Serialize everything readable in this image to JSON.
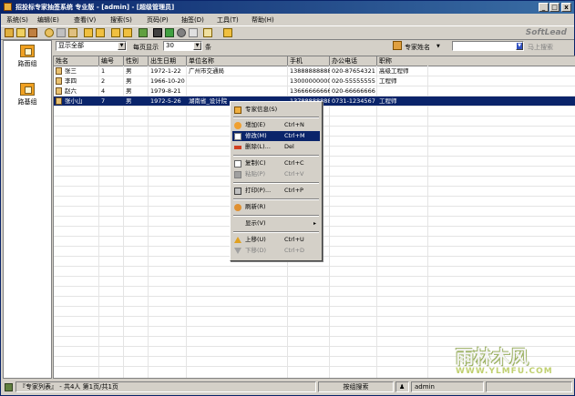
{
  "window": {
    "title": "招投标专家抽签系统 专业版 - [admin] - [超级管理员]",
    "min_label": "_",
    "max_label": "□",
    "close_label": "x"
  },
  "menu": [
    "系统(S)",
    "编辑(E)",
    "查看(V)",
    "搜索(S)",
    "页码(P)",
    "抽签(D)",
    "工具(T)",
    "帮助(H)"
  ],
  "toolbar": {
    "brand": "SoftLead"
  },
  "left_panel": {
    "items": [
      {
        "label": "路面组"
      },
      {
        "label": "路基组"
      }
    ]
  },
  "filter": {
    "show_select": "显示全部",
    "per_page_label": "每页显示",
    "per_page_value": "30",
    "per_page_unit": "条",
    "search_field_select": "专家姓名",
    "search_input": "",
    "search_button": "马上搜索"
  },
  "table": {
    "columns": [
      "姓名",
      "编号",
      "性别",
      "出生日期",
      "单位名称",
      "手机",
      "办公电话",
      "职称"
    ],
    "rows": [
      [
        "张三",
        "1",
        "男",
        "1972-1-22",
        "广州市交通局",
        "13888888888",
        "020-87654321",
        "高级工程师"
      ],
      [
        "李四",
        "2",
        "男",
        "1966-10-20",
        "",
        "13000000000",
        "020-55555555",
        "工程师"
      ],
      [
        "赵六",
        "4",
        "男",
        "1979-8-21",
        "",
        "13666666666",
        "020-66666666",
        ""
      ],
      [
        "张小山",
        "7",
        "男",
        "1972-5-26",
        "湖南省_设计院",
        "13788888888",
        "0731-1234567",
        "工程师"
      ]
    ],
    "selected_row": 3
  },
  "context_menu": {
    "items": [
      {
        "label": "专家信息(S)",
        "shortcut": "",
        "disabled": false,
        "highlight": false,
        "icon": "info-icon"
      },
      {
        "label": "增加(E)",
        "shortcut": "Ctrl+N",
        "disabled": false,
        "highlight": false,
        "icon": "add-icon"
      },
      {
        "label": "修改(M)",
        "shortcut": "Ctrl+M",
        "disabled": false,
        "highlight": true,
        "icon": "edit-icon"
      },
      {
        "label": "删除(L)...",
        "shortcut": "Del",
        "disabled": false,
        "highlight": false,
        "icon": "delete-icon"
      },
      {
        "label": "复制(C)",
        "shortcut": "Ctrl+C",
        "disabled": false,
        "highlight": false,
        "icon": "copy-icon"
      },
      {
        "label": "粘贴(P)",
        "shortcut": "Ctrl+V",
        "disabled": true,
        "highlight": false,
        "icon": "paste-icon"
      },
      {
        "label": "打印(P)...",
        "shortcut": "Ctrl+P",
        "disabled": false,
        "highlight": false,
        "icon": "print-icon"
      },
      {
        "label": "刷新(R)",
        "shortcut": "",
        "disabled": false,
        "highlight": false,
        "icon": "refresh-icon"
      },
      {
        "label": "显示(V)",
        "shortcut": "",
        "disabled": false,
        "highlight": false,
        "icon": "",
        "submenu": "▸"
      },
      {
        "label": "上移(U)",
        "shortcut": "Ctrl+U",
        "disabled": false,
        "highlight": false,
        "icon": "up-icon"
      },
      {
        "label": "下移(D)",
        "shortcut": "Ctrl+D",
        "disabled": true,
        "highlight": false,
        "icon": "down-icon"
      }
    ]
  },
  "status": {
    "list_info": "『专家列表』 - 共4人 第1页/共1页",
    "mode": "按组搜索",
    "user": "admin"
  },
  "watermark": {
    "brand": "雨林木风",
    "url": "WWW.YLMFU.COM"
  },
  "colors": {
    "title_start": "#0a246a",
    "title_end": "#3a6ea5",
    "selection": "#0a246a",
    "face": "#d4d0c8"
  }
}
